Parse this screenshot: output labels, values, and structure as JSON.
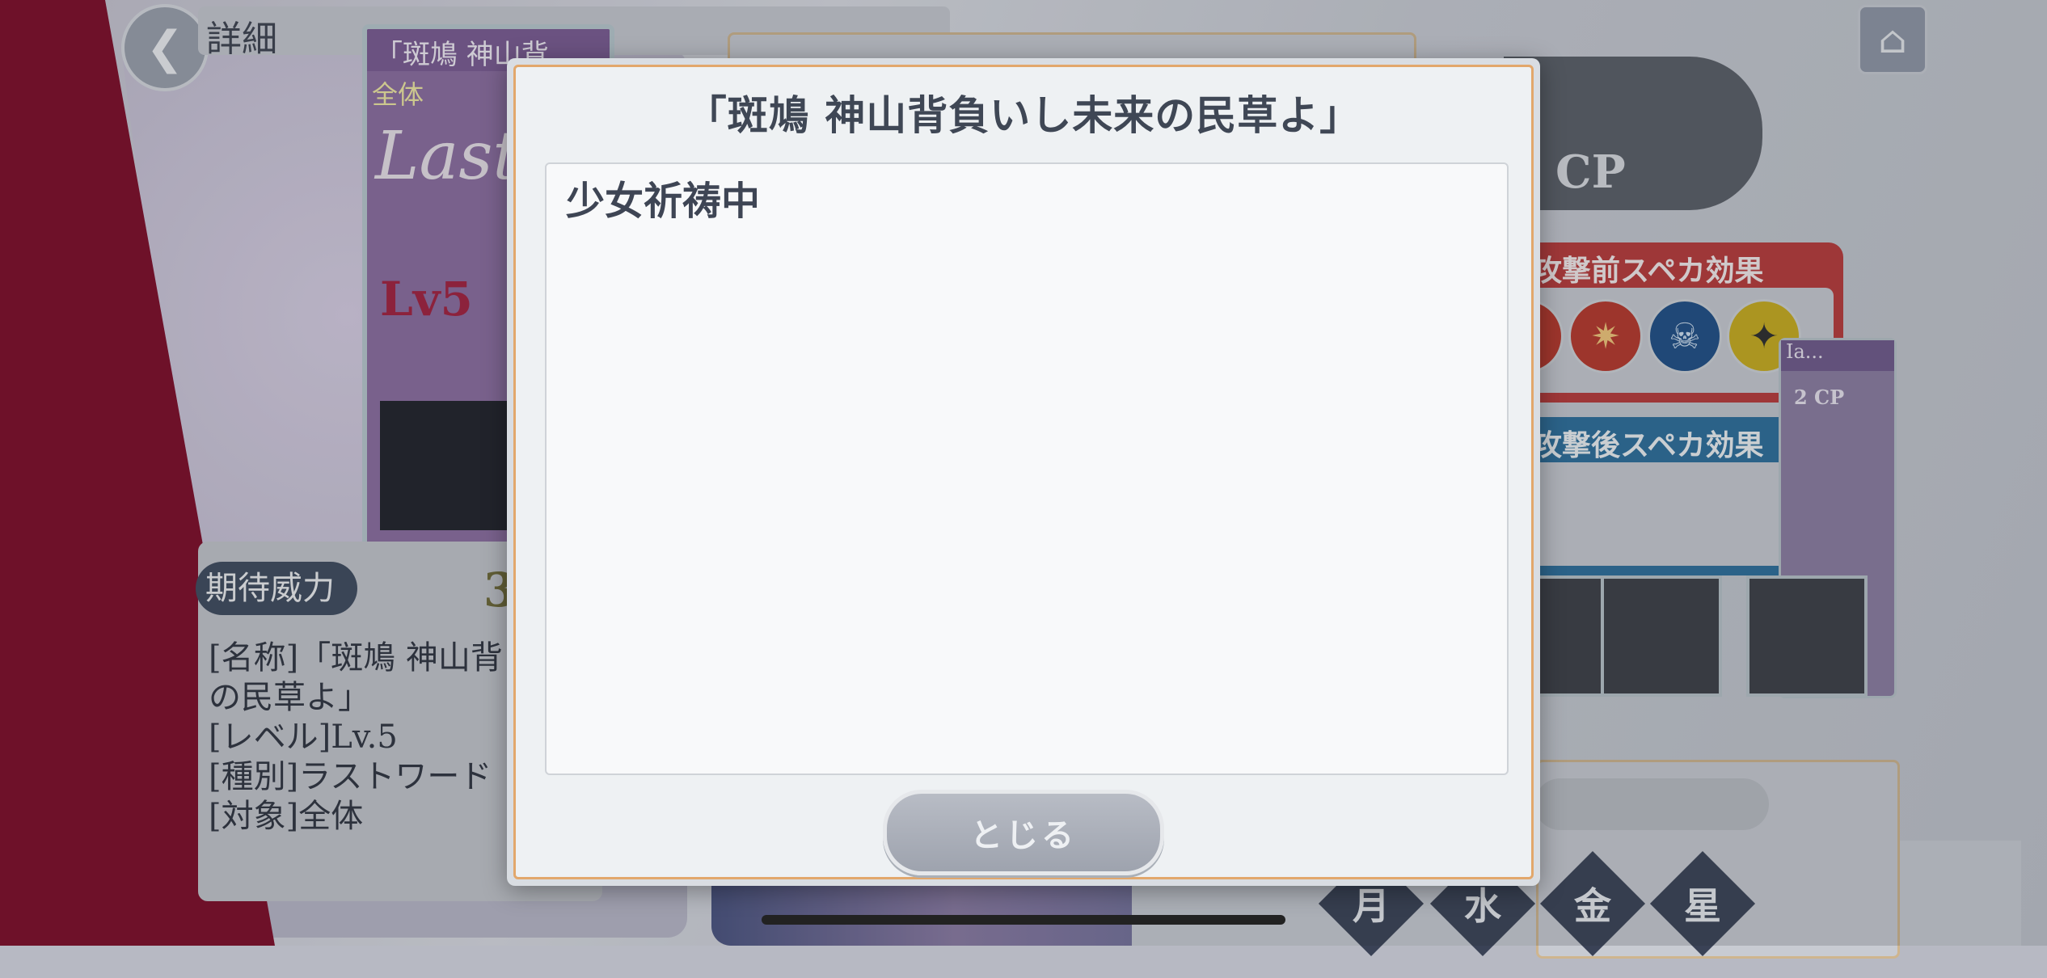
{
  "header": {
    "back_icon": "chevron-left-icon",
    "title": "詳細",
    "home_icon": "home-icon"
  },
  "card": {
    "title": "「斑鳩 神山背...",
    "target": "全体",
    "word": "Last W",
    "level": "Lv5"
  },
  "info": {
    "power_label": "期待威力",
    "power_value": "3",
    "details": [
      "[名称]「斑鳩 神山背",
      "の民草よ」",
      "[レベル]Lv.5",
      "[種別]ラストワード",
      "[対象]全体"
    ]
  },
  "right_panel": {
    "cp_label": "CP",
    "spe_before_label": "攻撃前スペカ効果",
    "spe_after_label": "攻撃後スペカ効果",
    "side_card_title": "Ia...",
    "side_card_cp": "2 CP",
    "days": [
      "月",
      "水",
      "金",
      "星"
    ]
  },
  "modal": {
    "title": "「斑鳩 神山背負いし未来の民草よ」",
    "content": "少女祈祷中",
    "close_label": "とじる"
  }
}
